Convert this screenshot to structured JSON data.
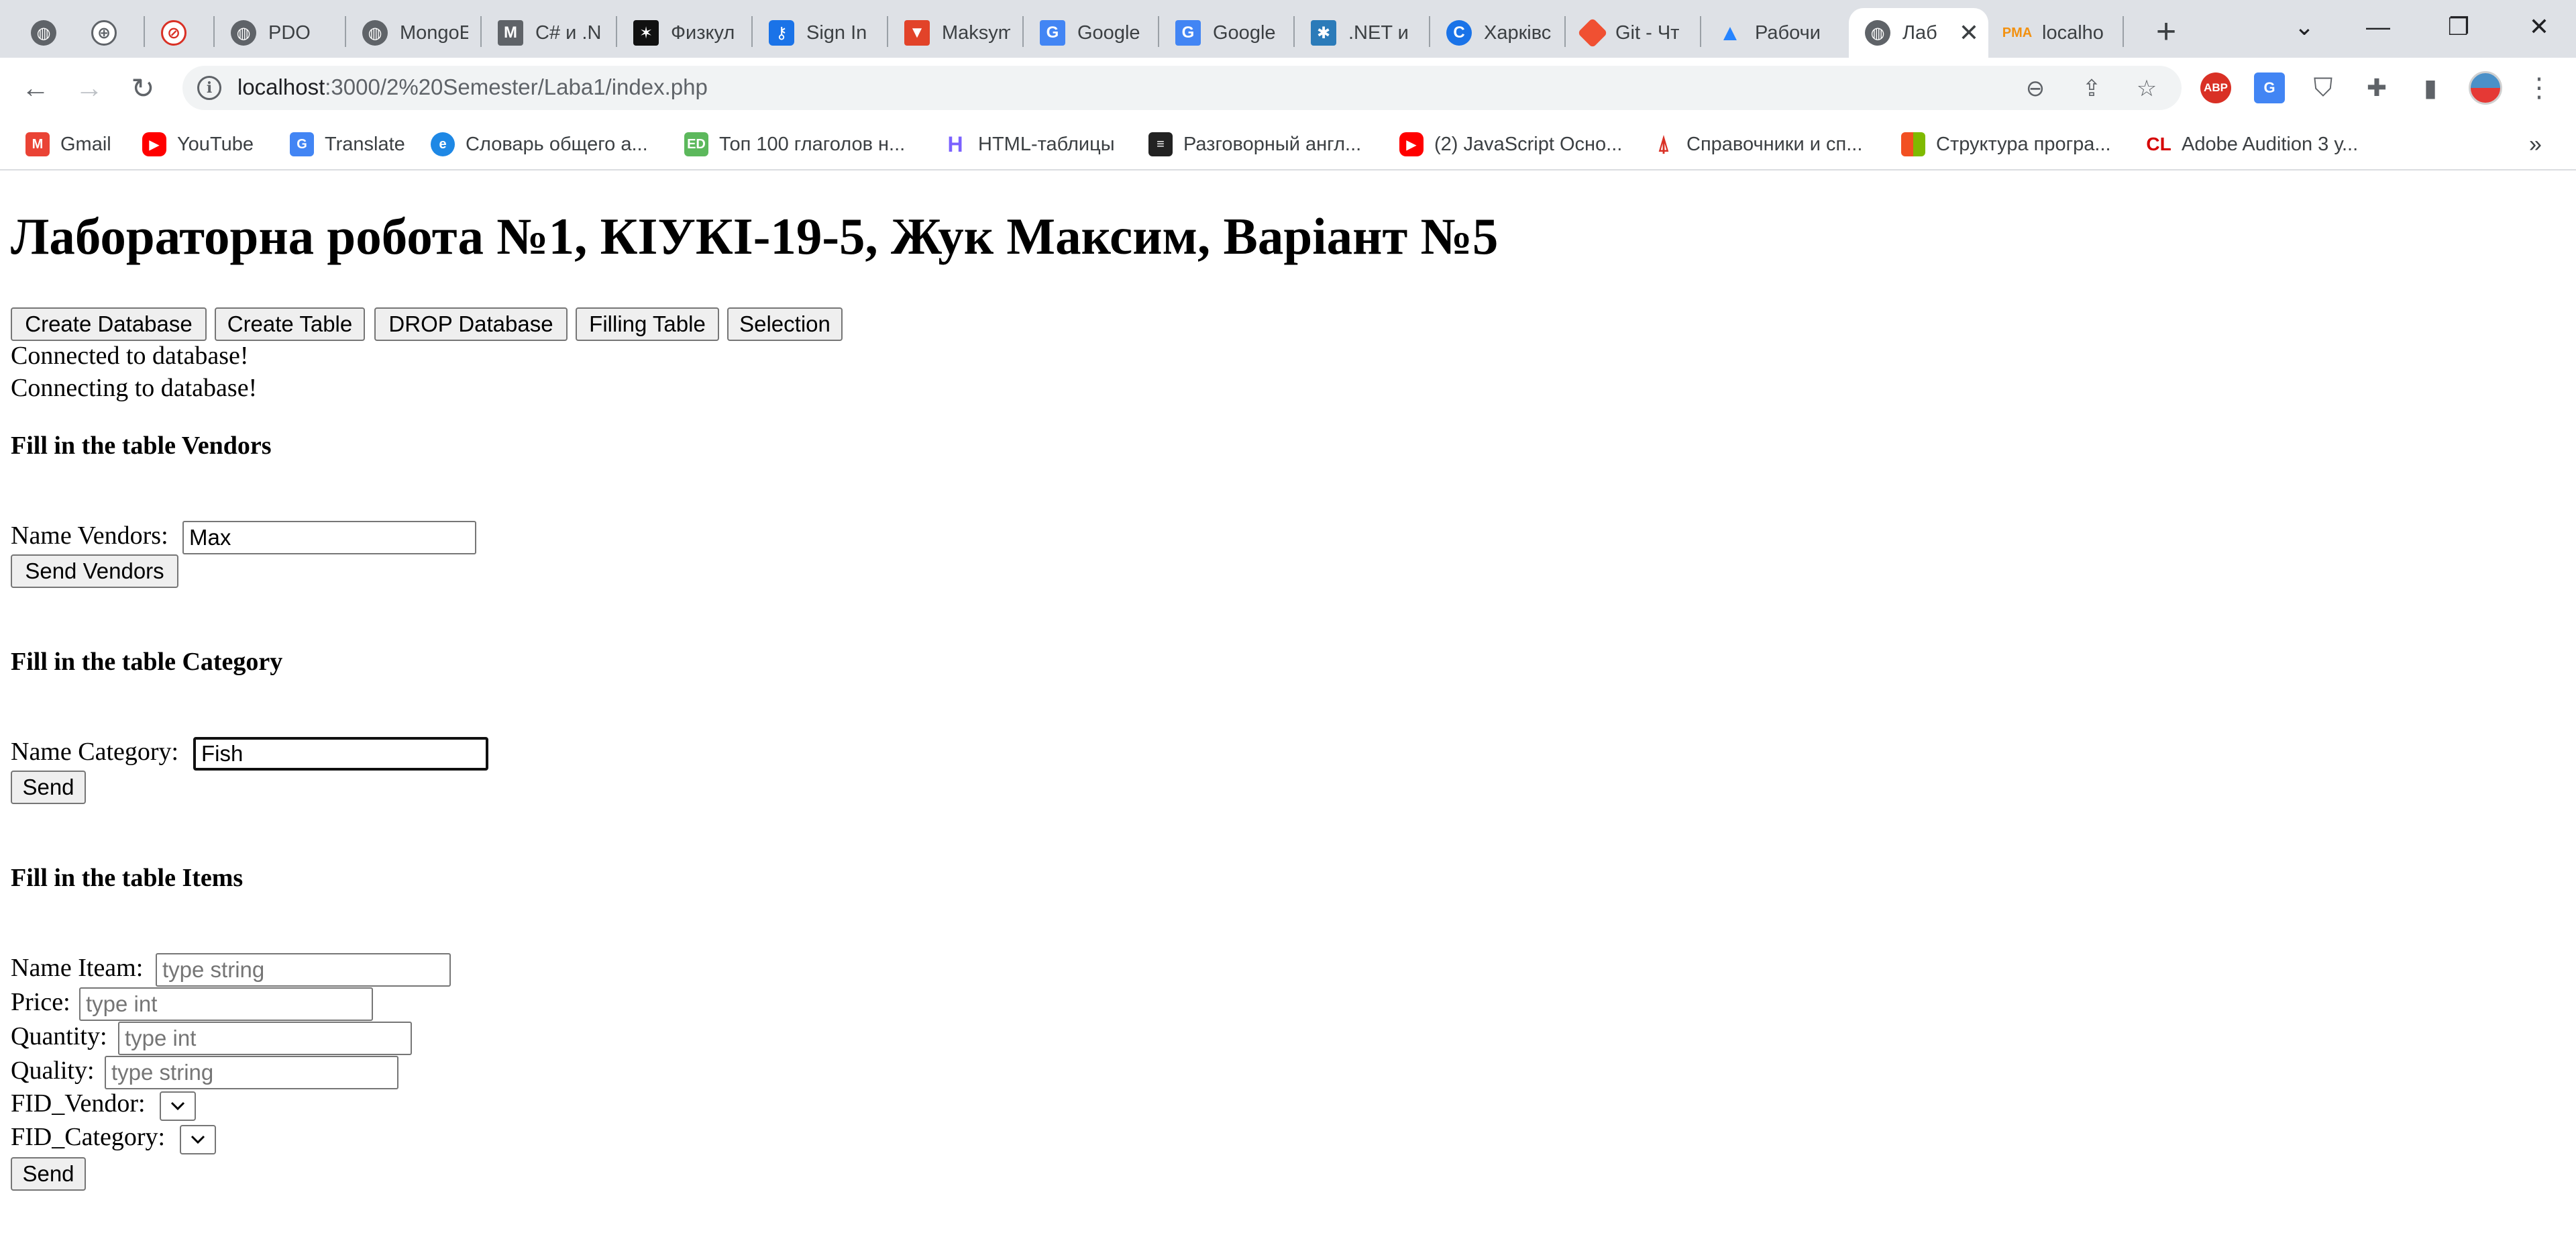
{
  "browser": {
    "tabs": [
      {
        "title": "",
        "icon": "globe-icon",
        "color": "#5f6368"
      },
      {
        "title": "",
        "icon": "globe-outline-icon",
        "color": "#5f6368"
      },
      {
        "title": "",
        "icon": "cancel-circle-icon",
        "color": "#d93025"
      },
      {
        "title": "PDO",
        "icon": "globe-icon",
        "color": "#5f6368"
      },
      {
        "title": "MongoE",
        "icon": "globe-icon",
        "color": "#5f6368"
      },
      {
        "title": "C# и .N",
        "icon": "m-logo-icon",
        "color": "#5f6368"
      },
      {
        "title": "Физкул",
        "icon": "dark-logo-icon",
        "color": "#111111"
      },
      {
        "title": "Sign In",
        "icon": "key-icon",
        "color": "#1a73e8"
      },
      {
        "title": "Maksym",
        "icon": "gitlab-icon",
        "color": "#e24329"
      },
      {
        "title": "Google",
        "icon": "google-translate-icon",
        "color": "#4285f4"
      },
      {
        "title": "Google",
        "icon": "google-translate-icon",
        "color": "#4285f4"
      },
      {
        "title": ".NET и",
        "icon": "dotnet-icon",
        "color": "#2b7bb9"
      },
      {
        "title": "Харківс",
        "icon": "c-logo-icon",
        "color": "#1a73e8"
      },
      {
        "title": "Git - Чт",
        "icon": "git-icon",
        "color": "#f05032"
      },
      {
        "title": "Рабочи",
        "icon": "atlassian-icon",
        "color": "#2684ff"
      },
      {
        "title": "Лаб",
        "icon": "globe-icon",
        "color": "#5f6368",
        "active": true
      },
      {
        "title": "localho",
        "icon": "phpmyadmin-icon",
        "color": "#f29111"
      }
    ],
    "url": {
      "host": "localhost",
      "path": ":3000/2%20Semester/Laba1/index.php"
    },
    "bookmarks": [
      {
        "label": "Gmail",
        "icon": "gmail-icon",
        "color": "#ea4335"
      },
      {
        "label": "YouTube",
        "icon": "youtube-icon",
        "color": "#ff0000"
      },
      {
        "label": "Translate",
        "icon": "google-translate-icon",
        "color": "#4285f4"
      },
      {
        "label": "Словарь общего а...",
        "icon": "e-logo-icon",
        "color": "#1e88e5"
      },
      {
        "label": "Топ 100 глаголов н...",
        "icon": "ed-logo-icon",
        "color": "#5cb85c"
      },
      {
        "label": "HTML-таблицы",
        "icon": "htmlbook-icon",
        "color": "#7b61ff"
      },
      {
        "label": "Разговорный англ...",
        "icon": "scroll-icon",
        "color": "#222222"
      },
      {
        "label": "(2) JavaScript Осно...",
        "icon": "youtube-icon",
        "color": "#ff0000"
      },
      {
        "label": "Справочники и сп...",
        "icon": "antenna-icon",
        "color": "#d93025"
      },
      {
        "label": "Структура програ...",
        "icon": "microsoft-icon",
        "color": "#f25022"
      },
      {
        "label": "Adobe Audition 3 у...",
        "icon": "cl-logo-icon",
        "color": "#d50000"
      }
    ]
  },
  "page": {
    "title": "Лабораторна робота №1, КІУКІ-19-5, Жук Максим, Варіант №5",
    "buttons": {
      "create_db": "Create Database",
      "create_table": "Create Table",
      "drop_db": "DROP Database",
      "filling": "Filling Table",
      "selection": "Selection"
    },
    "status": [
      "Connected to database!",
      "Connecting to database!"
    ],
    "vendors": {
      "heading": "Fill in the table Vendors",
      "label": "Name Vendors:",
      "value": "Max",
      "send": "Send Vendors"
    },
    "category": {
      "heading": "Fill in the table Category",
      "label": "Name Category:",
      "value": "Fish",
      "send": "Send"
    },
    "items": {
      "heading": "Fill in the table Items",
      "name_label": "Name Iteam:",
      "name_placeholder": "type string",
      "price_label": "Price:",
      "price_placeholder": "type int",
      "quantity_label": "Quantity:",
      "quantity_placeholder": "type int",
      "quality_label": "Quality:",
      "quality_placeholder": "type string",
      "fid_vendor_label": "FID_Vendor:",
      "fid_category_label": "FID_Category:",
      "send": "Send"
    }
  }
}
